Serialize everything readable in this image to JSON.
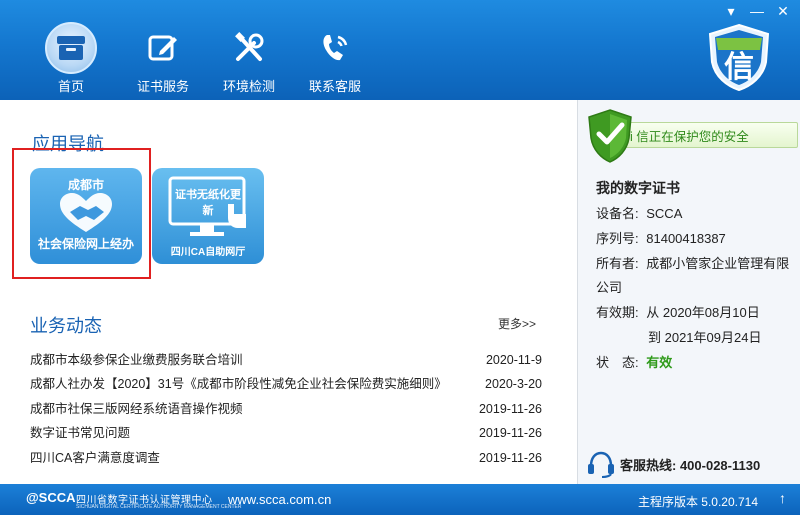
{
  "window": {
    "controls": [
      "▾",
      "—",
      "✕"
    ]
  },
  "nav": {
    "items": [
      {
        "label": "首页",
        "icon": "home-box-icon",
        "active": true
      },
      {
        "label": "证书服务",
        "icon": "edit-icon",
        "active": false
      },
      {
        "label": "环境检测",
        "icon": "tools-icon",
        "active": false
      },
      {
        "label": "联系客服",
        "icon": "phone-icon",
        "active": false
      }
    ],
    "logo_char": "信"
  },
  "apps": {
    "title": "应用导航",
    "items": [
      {
        "top": "成都市",
        "bottom": "社会保险网上经办",
        "icon": "handshake-heart-icon"
      },
      {
        "top": "证书无纸化更新",
        "bottom": "四川CA自助网厅",
        "icon": "monitor-hand-icon"
      }
    ]
  },
  "news": {
    "title": "业务动态",
    "more": "更多>>",
    "items": [
      {
        "title": "成都市本级参保企业缴费服务联合培训",
        "date": "2020-11-9"
      },
      {
        "title": "成都人社办发【2020】31号《成都市阶段性减免企业社会保险费实施细则》",
        "date": "2020-3-20"
      },
      {
        "title": "成都市社保三版网经系统语音操作视频",
        "date": "2019-11-26"
      },
      {
        "title": "数字证书常见问题",
        "date": "2019-11-26"
      },
      {
        "title": "四川CA客户满意度调查",
        "date": "2019-11-26"
      }
    ]
  },
  "security": {
    "banner": "i 信正在保护您的安全"
  },
  "cert": {
    "title": "我的数字证书",
    "device_label": "设备名:",
    "device": "SCCA",
    "serial_label": "序列号:",
    "serial": "81400418387",
    "owner_label": "所有者:",
    "owner_line1": "成都小管家企业管理有限",
    "owner_line2": "公司",
    "validity_label": "有效期:",
    "valid_from": "从 2020年08月10日",
    "valid_to": "到 2021年09月24日",
    "status_label": "状　态:",
    "status": "有效",
    "status_color": "#2f9a1a"
  },
  "hotline": {
    "text": "客服热线: 400-028-1130"
  },
  "footer": {
    "logo": "@SCCA",
    "org": "四川省数字证书认证管理中心",
    "org_en": "SICHUAN DIGITAL CERTIFICATE AUTHORITY MANAGEMENT CENTER",
    "url": "www.scca.com.cn",
    "version": "主程序版本 5.0.20.714",
    "update_icon": "↑"
  },
  "colors": {
    "header": "#1477cf",
    "accent": "#1a63b3",
    "highlight": "#e02020",
    "ok_green": "#2f8a1a"
  }
}
